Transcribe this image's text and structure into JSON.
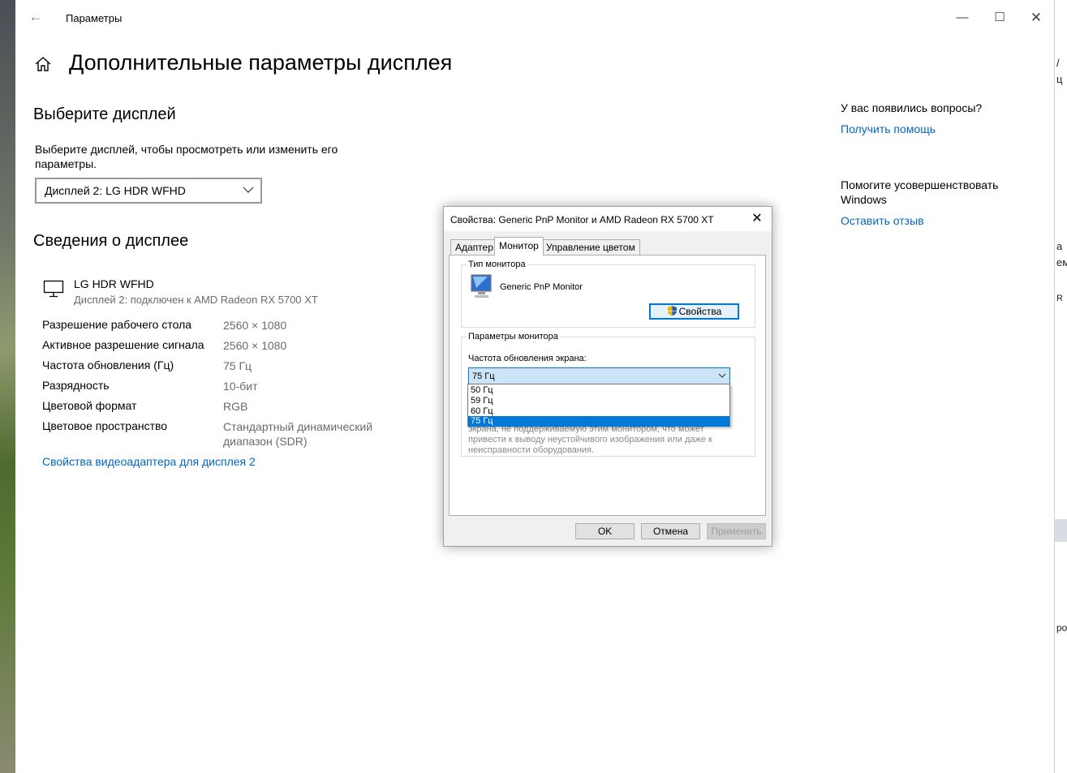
{
  "window": {
    "app_title": "Параметры",
    "back_glyph": "←",
    "min_glyph": "—",
    "max_glyph": "☐",
    "close_glyph": "✕"
  },
  "page": {
    "title": "Дополнительные параметры дисплея"
  },
  "choose_display": {
    "heading": "Выберите дисплей",
    "description": "Выберите дисплей, чтобы просмотреть или изменить его параметры.",
    "selected": "Дисплей 2: LG HDR WFHD"
  },
  "display_info": {
    "heading": "Сведения о дисплее",
    "monitor_name": "LG HDR WFHD",
    "monitor_sub": "Дисплей 2: подключен к AMD Radeon RX 5700 XT",
    "rows": [
      {
        "label": "Разрешение рабочего стола",
        "value": "2560 × 1080"
      },
      {
        "label": "Активное разрешение сигнала",
        "value": "2560 × 1080"
      },
      {
        "label": "Частота обновления (Гц)",
        "value": "75 Гц"
      },
      {
        "label": "Разрядность",
        "value": "10-бит"
      },
      {
        "label": "Цветовой формат",
        "value": "RGB"
      },
      {
        "label": "Цветовое пространство",
        "value": "Стандартный динамический диапазон (SDR)"
      }
    ],
    "adapter_link": "Свойства видеоадаптера для дисплея 2"
  },
  "sidebar": {
    "questions": "У вас появились вопросы?",
    "help_link": "Получить помощь",
    "improve": "Помогите усовершенствовать Windows",
    "feedback_link": "Оставить отзыв"
  },
  "dialog": {
    "title": "Свойства: Generic PnP Monitor и AMD Radeon RX 5700 XT",
    "close_glyph": "✕",
    "tabs": [
      "Адаптер",
      "Монитор",
      "Управление цветом"
    ],
    "active_tab": "Монитор",
    "monitor_type_group": "Тип монитора",
    "monitor_type": "Generic PnP Monitor",
    "properties_button": "Свойства",
    "monitor_params_group": "Параметры монитора",
    "refresh_label": "Частота обновления экрана:",
    "refresh_value": "75 Гц",
    "refresh_options": [
      "50 Гц",
      "59 Гц",
      "60 Гц",
      "75 Гц"
    ],
    "warning_partial": "экрана, не поддерживаемую этим монитором, что может привести к выводу неустойчивого изображения или даже к неисправности оборудования.",
    "ok_button": "OK",
    "cancel_button": "Отмена",
    "apply_button": "Применить"
  },
  "background_fragments": [
    "/",
    "ц",
    "а",
    "ем",
    "R",
    "ро"
  ]
}
